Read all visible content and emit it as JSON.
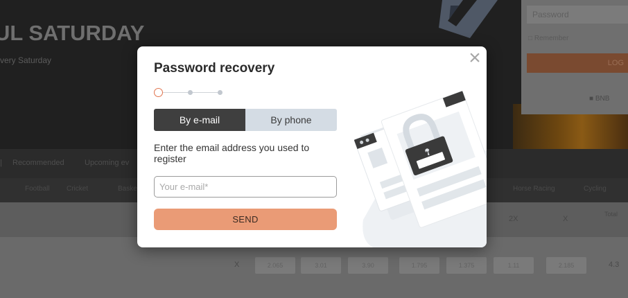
{
  "background": {
    "hero_title": "UL SATURDAY",
    "hero_subtitle": "very Saturday",
    "login_placeholder": "Password",
    "remember_label": "Remember",
    "login_button": "LOG",
    "secondary_button": "■ BNB",
    "nav_items": [
      "Recommended",
      "Upcoming ev"
    ],
    "sport_items": [
      "Football",
      "Cricket",
      "Basket",
      "Horse Racing",
      "Cycling"
    ],
    "table_headers": [
      "2X",
      "X",
      "Total"
    ],
    "odds": [
      "2.065",
      "3.01",
      "3.90",
      "1.795",
      "1.375",
      "1.11",
      "2.185"
    ],
    "row_marker": "X",
    "row_value": "4.3"
  },
  "modal": {
    "title": "Password recovery",
    "steps": {
      "total": 3,
      "current": 1
    },
    "tabs": [
      {
        "label": "By e-mail",
        "active": true
      },
      {
        "label": "By phone",
        "active": false
      }
    ],
    "instruction": "Enter the email address you used to register",
    "email_placeholder": "Your e-mail*",
    "email_value": "",
    "send_label": "SEND",
    "close_icon": "close-icon",
    "password_mask": "***"
  },
  "colors": {
    "accent": "#e0734d",
    "send_button": "#ea9b76",
    "tab_active": "#3f3f3f",
    "tab_inactive": "#d4dce4"
  }
}
